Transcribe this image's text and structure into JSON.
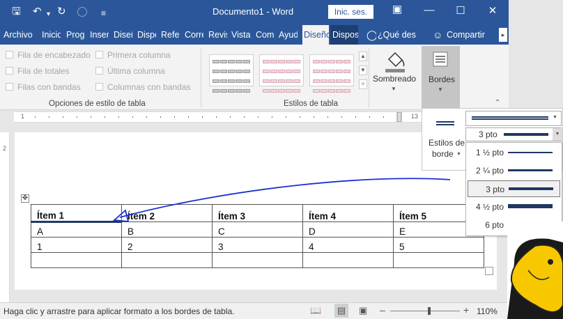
{
  "window": {
    "title": "Documento1 - Word",
    "signin_label": "Inic. ses."
  },
  "tabs": [
    "Archivo",
    "Inicio",
    "Prog",
    "Inser",
    "Diseñ",
    "Dispo",
    "Refer",
    "Corre",
    "Revis",
    "Vista",
    "Com",
    "Ayud",
    "Diseño",
    "Dispos",
    "¿Qué des",
    "Compartir"
  ],
  "ribbon": {
    "style_options": {
      "label": "Opciones de estilo de tabla",
      "items": [
        "Fila de encabezado",
        "Primera columna",
        "Fila de totales",
        "Última columna",
        "Filas con bandas",
        "Columnas con bandas"
      ]
    },
    "table_styles": {
      "label": "Estilos de tabla"
    },
    "shading_label": "Sombreado",
    "borders_label": "Bordes"
  },
  "border_panel": {
    "styles_label_line1": "Estilos de",
    "styles_label_line2": "borde",
    "weight_current": "3 pto",
    "weights": [
      "1 ½ pto",
      "2 ¼ pto",
      "3 pto",
      "4 ½ pto",
      "6 pto"
    ]
  },
  "ruler": {
    "left_num": "1",
    "right_num": "13",
    "vert_num": "2"
  },
  "doc_table": {
    "header": [
      "Ítem 1",
      "Ítem 2",
      "Ítem 3",
      "Ítem 4",
      "Ítem 5"
    ],
    "rows": [
      [
        "A",
        "B",
        "C",
        "D",
        "E"
      ],
      [
        "1",
        "2",
        "3",
        "4",
        "5"
      ],
      [
        "",
        "",
        "",
        "",
        ""
      ]
    ]
  },
  "status": {
    "message": "Haga clic y arrastre para aplicar formato a los bordes de tabla.",
    "zoom": "110%"
  },
  "colors": {
    "word_blue": "#2b579a",
    "border_navy": "#1f3864",
    "annotation": "#1a2fd0"
  }
}
